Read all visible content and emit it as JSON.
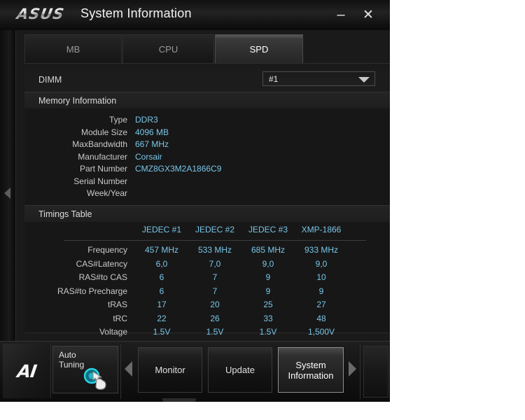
{
  "window": {
    "brand_logo": "ASUS",
    "title": "System Information",
    "minimize_label": "–",
    "close_label": "✕",
    "collapse_arrow_icon": "chevron-left-icon"
  },
  "tabs": [
    {
      "label": "MB",
      "active": false
    },
    {
      "label": "CPU",
      "active": false
    },
    {
      "label": "SPD",
      "active": true
    }
  ],
  "dimm": {
    "label": "DIMM",
    "selected": "#1",
    "options": [
      "#1"
    ]
  },
  "memory_information": {
    "section_title": "Memory Information",
    "rows": [
      {
        "label": "Type",
        "value": "DDR3"
      },
      {
        "label": "Module Size",
        "value": "4096 MB"
      },
      {
        "label": "MaxBandwidth",
        "value": "667 MHz"
      },
      {
        "label": "Manufacturer",
        "value": "Corsair"
      },
      {
        "label": "Part Number",
        "value": "CMZ8GX3M2A1866C9"
      },
      {
        "label": "Serial Number",
        "value": ""
      },
      {
        "label": "Week/Year",
        "value": ""
      }
    ]
  },
  "timings_table": {
    "section_title": "Timings Table",
    "columns": [
      "JEDEC #1",
      "JEDEC #2",
      "JEDEC #3",
      "XMP-1866"
    ],
    "rows": [
      {
        "label": "Frequency",
        "values": [
          "457 MHz",
          "533 MHz",
          "685 MHz",
          "933 MHz"
        ]
      },
      {
        "label": "CAS#Latency",
        "values": [
          "6,0",
          "7,0",
          "9,0",
          "9,0"
        ]
      },
      {
        "label": "RAS#to CAS",
        "values": [
          "6",
          "7",
          "9",
          "10"
        ]
      },
      {
        "label": "RAS#to Precharge",
        "values": [
          "6",
          "7",
          "9",
          "9"
        ]
      },
      {
        "label": "tRAS",
        "values": [
          "17",
          "20",
          "25",
          "27"
        ]
      },
      {
        "label": "tRC",
        "values": [
          "22",
          "26",
          "33",
          "48"
        ]
      },
      {
        "label": "Voltage",
        "values": [
          "1.5V",
          "1.5V",
          "1.5V",
          "1,500V"
        ]
      }
    ]
  },
  "toolbar": {
    "suite_logo": "AI",
    "auto_tuning_label": "Auto\nTuning",
    "auto_tuning_line1": "Auto",
    "auto_tuning_line2": "Tuning",
    "cursor_icon": "hand-click-icon",
    "prev_arrow_icon": "chevron-left-icon",
    "next_arrow_icon": "chevron-right-icon",
    "buttons": [
      {
        "label": "Monitor",
        "active": false
      },
      {
        "label": "Update",
        "active": false
      },
      {
        "label": "System Information",
        "active": true
      }
    ]
  },
  "colors": {
    "value_blue": "#79c6e8",
    "label_gray": "#c9c9c9",
    "panel_bg": "#1a1a1a",
    "accent_teal": "#1fb5c4"
  }
}
